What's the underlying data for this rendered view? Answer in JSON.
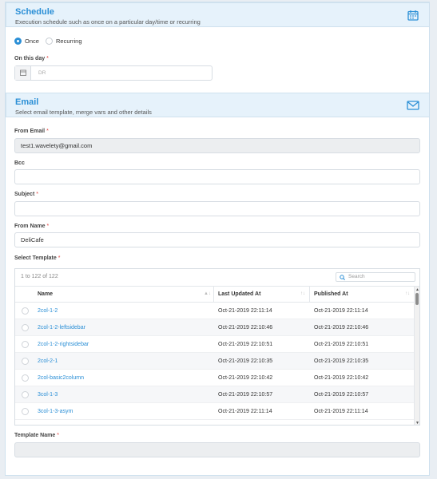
{
  "schedule": {
    "title": "Schedule",
    "subtitle": "Execution schedule such as once on a particular day/time or recurring",
    "icon": "calendar-icon",
    "radio_once": "Once",
    "radio_recurring": "Recurring",
    "selected": "Once",
    "on_this_day_label": "On this day",
    "on_this_day_placeholder": "DR",
    "required_mark": "*"
  },
  "email": {
    "title": "Email",
    "subtitle": "Select email template, merge vars and other details",
    "icon": "envelope-icon",
    "from_email_label": "From Email",
    "from_email_value": "test1.wavelety@gmail.com",
    "bcc_label": "Bcc",
    "bcc_value": "",
    "subject_label": "Subject",
    "subject_value": "",
    "from_name_label": "From Name",
    "from_name_value": "DeliCafe",
    "select_template_label": "Select Template",
    "template_name_label": "Template Name",
    "template_name_value": ""
  },
  "grid": {
    "pager_text": "1 to 122 of 122",
    "search_placeholder": "Search",
    "columns": [
      "Name",
      "Last Updated At",
      "Published At"
    ],
    "rows": [
      {
        "name": "2col-1-2",
        "updated": "Oct-21-2019 22:11:14",
        "published": "Oct-21-2019 22:11:14"
      },
      {
        "name": "2col-1-2-leftsidebar",
        "updated": "Oct-21-2019 22:10:46",
        "published": "Oct-21-2019 22:10:46"
      },
      {
        "name": "2col-1-2-rightsidebar",
        "updated": "Oct-21-2019 22:10:51",
        "published": "Oct-21-2019 22:10:51"
      },
      {
        "name": "2col-2-1",
        "updated": "Oct-21-2019 22:10:35",
        "published": "Oct-21-2019 22:10:35"
      },
      {
        "name": "2col-basic2column",
        "updated": "Oct-21-2019 22:10:42",
        "published": "Oct-21-2019 22:10:42"
      },
      {
        "name": "3col-1-3",
        "updated": "Oct-21-2019 22:10:57",
        "published": "Oct-21-2019 22:10:57"
      },
      {
        "name": "3col-1-3-asym",
        "updated": "Oct-21-2019 22:11:14",
        "published": "Oct-21-2019 22:11:14"
      }
    ]
  },
  "colors": {
    "accent": "#2b8fd6",
    "header_bg": "#e6f2fb",
    "required": "#e0413e"
  }
}
